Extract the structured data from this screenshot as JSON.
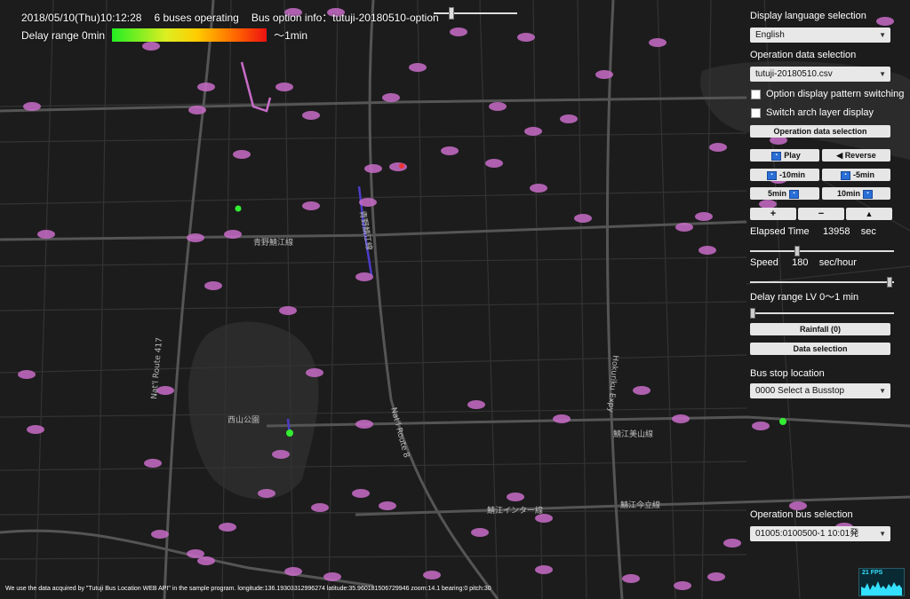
{
  "status": {
    "datetime": "2018/05/10(Thu)10:12:28",
    "buses_operating": "6 buses operating",
    "bus_option_info": "Bus option info：tutuji-20180510-option"
  },
  "delay_legend": {
    "start_label": "Delay range 0min",
    "end_label": "～1min"
  },
  "panel": {
    "display_language_label": "Display language selection",
    "display_language_value": "English",
    "operation_data_label": "Operation data selection",
    "operation_data_value": "tutuji-20180510.csv",
    "option_pattern_label": "Option display pattern switching",
    "arch_layer_label": "Switch arch layer display",
    "operation_data_button": "Operation data selection",
    "play_button": "Play",
    "reverse_button": "◀ Reverse",
    "minus10_button": "-10min",
    "minus5_button": "-5min",
    "plus5_button": "5min",
    "plus10_button": "10min",
    "zoom_in_button": "+",
    "zoom_out_button": "−",
    "compass_button": "▲",
    "elapsed_label": "Elapsed Time",
    "elapsed_value": "13958",
    "elapsed_unit": "sec",
    "speed_label": "Speed",
    "speed_value": "180",
    "speed_unit": "sec/hour",
    "delay_range_label": "Delay range LV 0～1 min",
    "rainfall_button": "Rainfall (0)",
    "data_selection_button": "Data selection",
    "busstop_label": "Bus stop location",
    "busstop_value": "0000 Select a Busstop",
    "operation_bus_label": "Operation bus selection",
    "operation_bus_value": "01005:0100500-1 10:01発"
  },
  "footer": {
    "text": "We use the data acquired by \"Tutuji Bus Location WEB API\" in the sample program.  longitude:136.19303312996274  latitude:35.960181506729946  zoom:14.1  bearing:0  pitch:30"
  },
  "fps": {
    "label": "21 FPS"
  },
  "map_labels": {
    "nishiyama_park": "西山公園",
    "aono_sabae_line1": "青野鯖江線",
    "aono_sabae_line2": "青野鯖江線",
    "sabae_higashi": "鯖江美山線",
    "sabae_imadate": "鯖江今立線",
    "sabae_ic": "鯖江インター線",
    "nat_route_417": "Nat'l Route 417",
    "nat_route_8": "Nat'l Route 8",
    "hokuriku_exwy": "Hokuriku Expy"
  },
  "colors": {
    "map_bg": "#1c1c1c",
    "road": "#3a3a3a",
    "major_road": "#5a5a5a",
    "bus_stop": "#c86cc8",
    "bus_green": "#33ee33",
    "route_line": "#4b3cc8"
  }
}
